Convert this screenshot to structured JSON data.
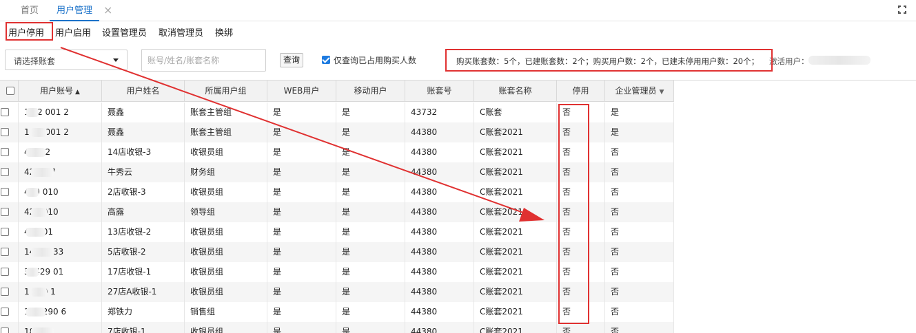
{
  "tabs": {
    "home": "首页",
    "active": "用户管理",
    "close_icon": "×"
  },
  "toolbar": {
    "disable_user": "用户停用",
    "enable_user": "用户启用",
    "set_admin": "设置管理员",
    "cancel_admin": "取消管理员",
    "rebind": "换绑"
  },
  "filters": {
    "account_select": "请选择账套",
    "search_placeholder": "账号/姓名/账套名称",
    "query_button": "查询",
    "only_occupied_label": "仅查询已占用购买人数",
    "only_occupied_checked": true
  },
  "summary": {
    "text": "购买账套数：5个，已建账套数：2个；购买用户数：2个，已建未停用用户数：20个；",
    "activated_label": "激活用户："
  },
  "grid": {
    "columns": [
      "用户账号",
      "用户姓名",
      "所属用户组",
      "WEB用户",
      "移动用户",
      "账套号",
      "账套名称",
      "停用",
      "企业管理员"
    ],
    "sort_asc_icon": "▲",
    "sort_desc_icon": "▼",
    "rows": [
      {
        "account": "1 12 001 2",
        "name": "聂鑫",
        "group": "账套主管组",
        "web": "是",
        "mobile": "是",
        "set_no": "43732",
        "set_name": "C账套",
        "disabled": "否",
        "admin": "是"
      },
      {
        "account": "1 12 001 2",
        "name": "聂鑫",
        "group": "账套主管组",
        "web": "是",
        "mobile": "是",
        "set_no": "44380",
        "set_name": "C账套2021",
        "disabled": "否",
        "admin": "是"
      },
      {
        "account": "42 2 2",
        "name": "14店收银-3",
        "group": "收银员组",
        "web": "是",
        "mobile": "是",
        "set_no": "44380",
        "set_name": "C账套2021",
        "disabled": "否",
        "admin": "否"
      },
      {
        "account": "429 9 7",
        "name": "牛秀云",
        "group": "财务组",
        "web": "是",
        "mobile": "是",
        "set_no": "44380",
        "set_name": "C账套2021",
        "disabled": "否",
        "admin": "否"
      },
      {
        "account": "429 010",
        "name": "2店收银-3",
        "group": "收银员组",
        "web": "是",
        "mobile": "是",
        "set_no": "44380",
        "set_name": "C账套2021",
        "disabled": "否",
        "admin": "否"
      },
      {
        "account": "429 010",
        "name": "高露",
        "group": "领导组",
        "web": "是",
        "mobile": "是",
        "set_no": "44380",
        "set_name": "C账套2021",
        "disabled": "否",
        "admin": "否"
      },
      {
        "account": "429 01",
        "name": "13店收银-2",
        "group": "收银员组",
        "web": "是",
        "mobile": "是",
        "set_no": "44380",
        "set_name": "C账套2021",
        "disabled": "否",
        "admin": "否"
      },
      {
        "account": "1429 133",
        "name": "5店收银-2",
        "group": "收银员组",
        "web": "是",
        "mobile": "是",
        "set_no": "44380",
        "set_name": "C账套2021",
        "disabled": "否",
        "admin": "否"
      },
      {
        "account": "31429 01",
        "name": "17店收银-1",
        "group": "收银员组",
        "web": "是",
        "mobile": "是",
        "set_no": "44380",
        "set_name": "C账套2021",
        "disabled": "否",
        "admin": "否"
      },
      {
        "account": "1 429 1",
        "name": "27店A收银-1",
        "group": "收银员组",
        "web": "是",
        "mobile": "是",
        "set_no": "44380",
        "set_name": "C账套2021",
        "disabled": "否",
        "admin": "否"
      },
      {
        "account": "181 290 6",
        "name": "郑铁力",
        "group": "销售组",
        "web": "是",
        "mobile": "是",
        "set_no": "44380",
        "set_name": "C账套2021",
        "disabled": "否",
        "admin": "否"
      },
      {
        "account": "181 7",
        "name": "7店收银-1",
        "group": "收银员组",
        "web": "是",
        "mobile": "是",
        "set_no": "44380",
        "set_name": "C账套2021",
        "disabled": "否",
        "admin": "否"
      }
    ]
  },
  "annotation_color": "#e03131",
  "accent_color": "#1b72c9"
}
